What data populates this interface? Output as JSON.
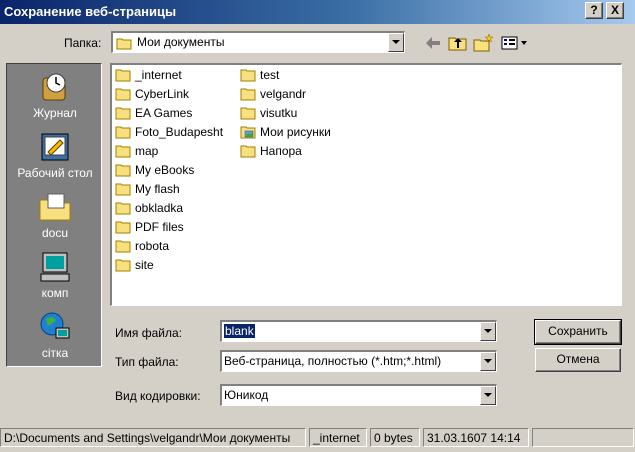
{
  "window": {
    "title": "Сохранение веб-страницы",
    "help_label": "?",
    "close_label": "X"
  },
  "lookin": {
    "label": "Папка:",
    "value": "Мои документы"
  },
  "toolbar": {
    "icons": [
      "back-arrow-icon",
      "up-folder-icon",
      "new-folder-icon",
      "view-menu-icon"
    ]
  },
  "places": [
    {
      "label": "Журнал",
      "icon": "history-icon"
    },
    {
      "label": "Рабочий стол",
      "icon": "desktop-icon"
    },
    {
      "label": "docu",
      "icon": "folder-icon"
    },
    {
      "label": "комп",
      "icon": "computer-icon"
    },
    {
      "label": "сітка",
      "icon": "network-icon"
    }
  ],
  "files": {
    "column1": [
      "_internet",
      "CyberLink",
      "EA Games",
      "Foto_Budapesht",
      "map",
      "My eBooks",
      "My flash",
      "obkladka",
      "PDF files",
      "robota",
      "site"
    ],
    "column2": [
      "test",
      "velgandr",
      "visutku",
      "Мои рисунки",
      "Напора"
    ]
  },
  "form": {
    "filename_label": "Имя файла:",
    "filename_value": "blank",
    "filetype_label": "Тип файла:",
    "filetype_value": "Веб-страница, полностью (*.htm;*.html)",
    "encoding_label": "Вид кодировки:",
    "encoding_value": "Юникод"
  },
  "buttons": {
    "save": "Сохранить",
    "cancel": "Отмена"
  },
  "status": {
    "path": "D:\\Documents and Settings\\velgandr\\Мои документы",
    "name": "_internet",
    "size": "0 bytes",
    "date": "31.03.1607 14:14"
  },
  "colors": {
    "titlebar_start": "#0a246a",
    "titlebar_end": "#a6caf0",
    "selection": "#0a246a",
    "folder": "#f8e080"
  }
}
